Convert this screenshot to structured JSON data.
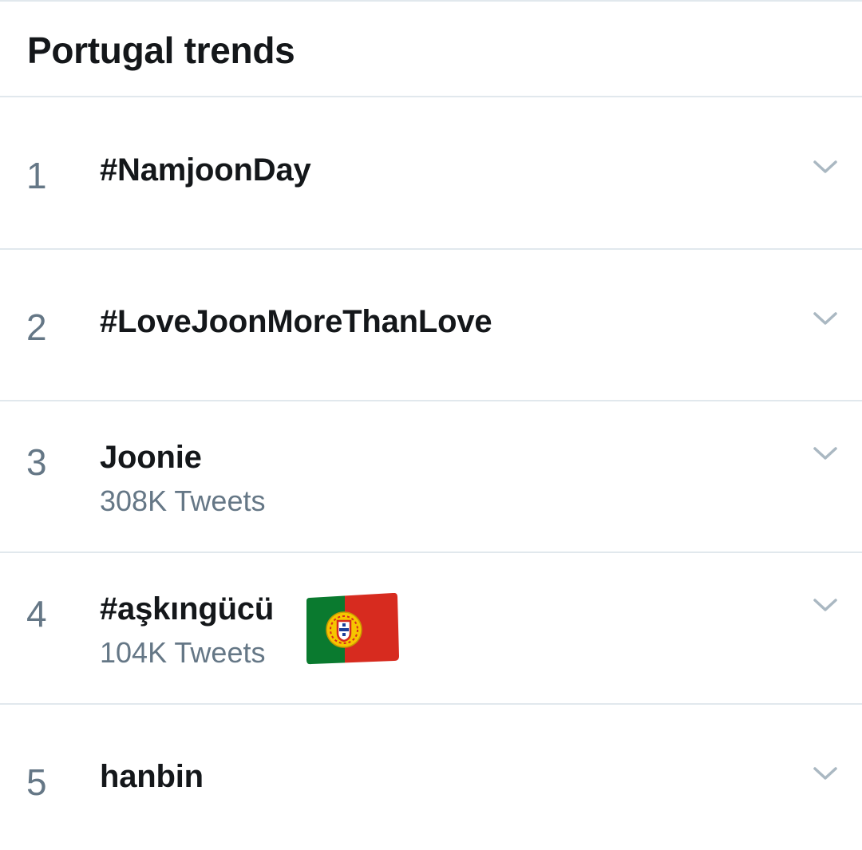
{
  "header": {
    "title": "Portugal trends"
  },
  "trends": [
    {
      "rank": "1",
      "name": "#NamjoonDay",
      "count": ""
    },
    {
      "rank": "2",
      "name": "#LoveJoonMoreThanLove",
      "count": ""
    },
    {
      "rank": "3",
      "name": "Joonie",
      "count": "308K Tweets"
    },
    {
      "rank": "4",
      "name": "#aşkıngücü",
      "count": "104K Tweets"
    },
    {
      "rank": "5",
      "name": "hanbin",
      "count": ""
    }
  ],
  "icons": {
    "chevron": "chevron-down-icon",
    "flag": "portugal-flag-icon"
  },
  "colors": {
    "text_primary": "#14171a",
    "text_secondary": "#657786",
    "divider": "#e1e8ed",
    "chevron": "#aab8c2"
  }
}
